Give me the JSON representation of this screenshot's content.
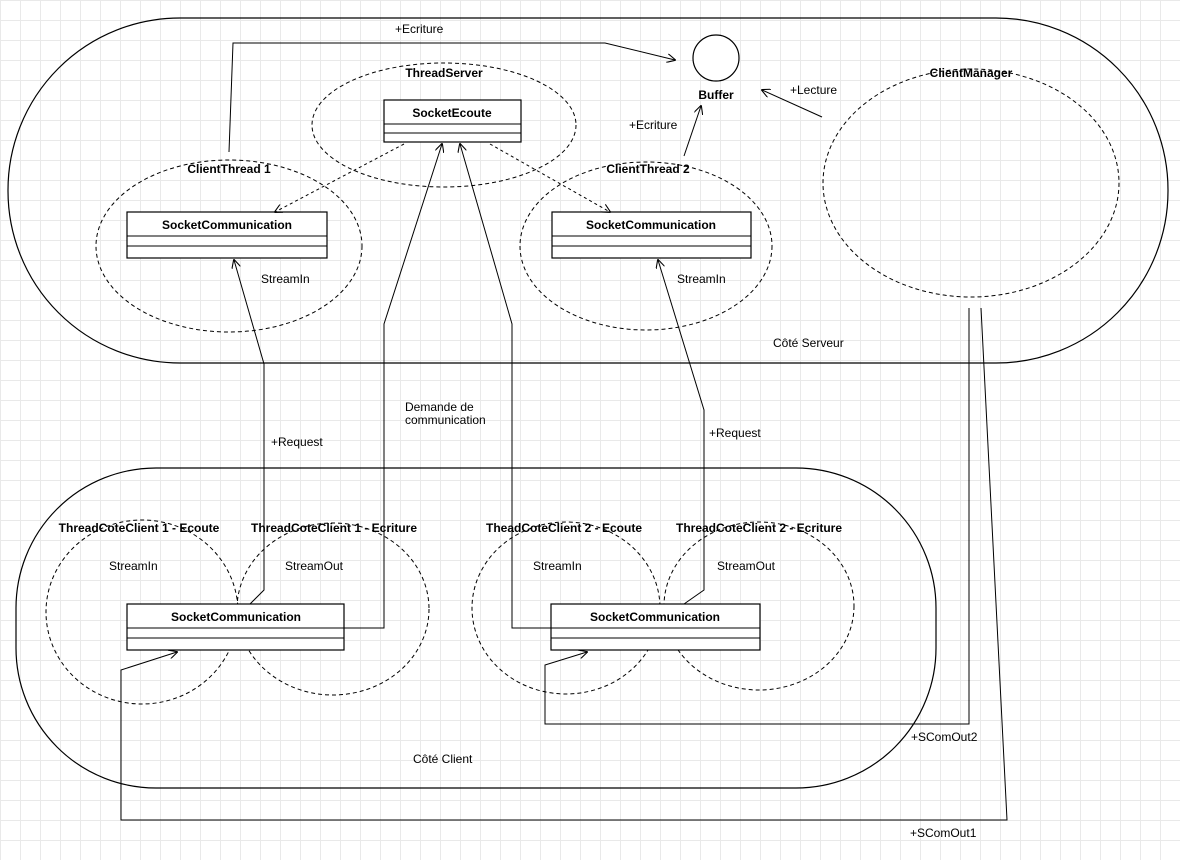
{
  "regions": {
    "server": "Côté Serveur",
    "client": "Côté Client"
  },
  "components": {
    "thread_server": "ThreadServer",
    "client_thread_1": "ClientThread 1",
    "client_thread_2": "ClientThread 2",
    "client_manager": "ClientManager",
    "buffer": "Buffer",
    "client1_listen": "ThreadCoteClient 1 - Ecoute",
    "client1_write": "ThreadCoteClient 1 - Ecriture",
    "client2_listen": "TheadCoteClient 2 - Ecoute",
    "client2_write": "ThreadCoteClient 2 - Ecriture"
  },
  "classes": {
    "socket_ecoute": "SocketEcoute",
    "ct1_socket": "SocketCommunication",
    "ct2_socket": "SocketCommunication",
    "c1_socket": "SocketCommunication",
    "c2_socket": "SocketCommunication"
  },
  "labels": {
    "ecriture_top": "+Ecriture",
    "ecriture_ct2": "+Ecriture",
    "lecture": "+Lecture",
    "streamin_ct1": "StreamIn",
    "streamin_ct2": "StreamIn",
    "demande_line1": "Demande de",
    "demande_line2": "communication",
    "request_1": "+Request",
    "request_2": "+Request",
    "c1_streamin": "StreamIn",
    "c1_streamout": "StreamOut",
    "c2_streamin": "StreamIn",
    "c2_streamout": "StreamOut",
    "scomout2": "+SComOut2",
    "scomout1": "+SComOut1"
  }
}
